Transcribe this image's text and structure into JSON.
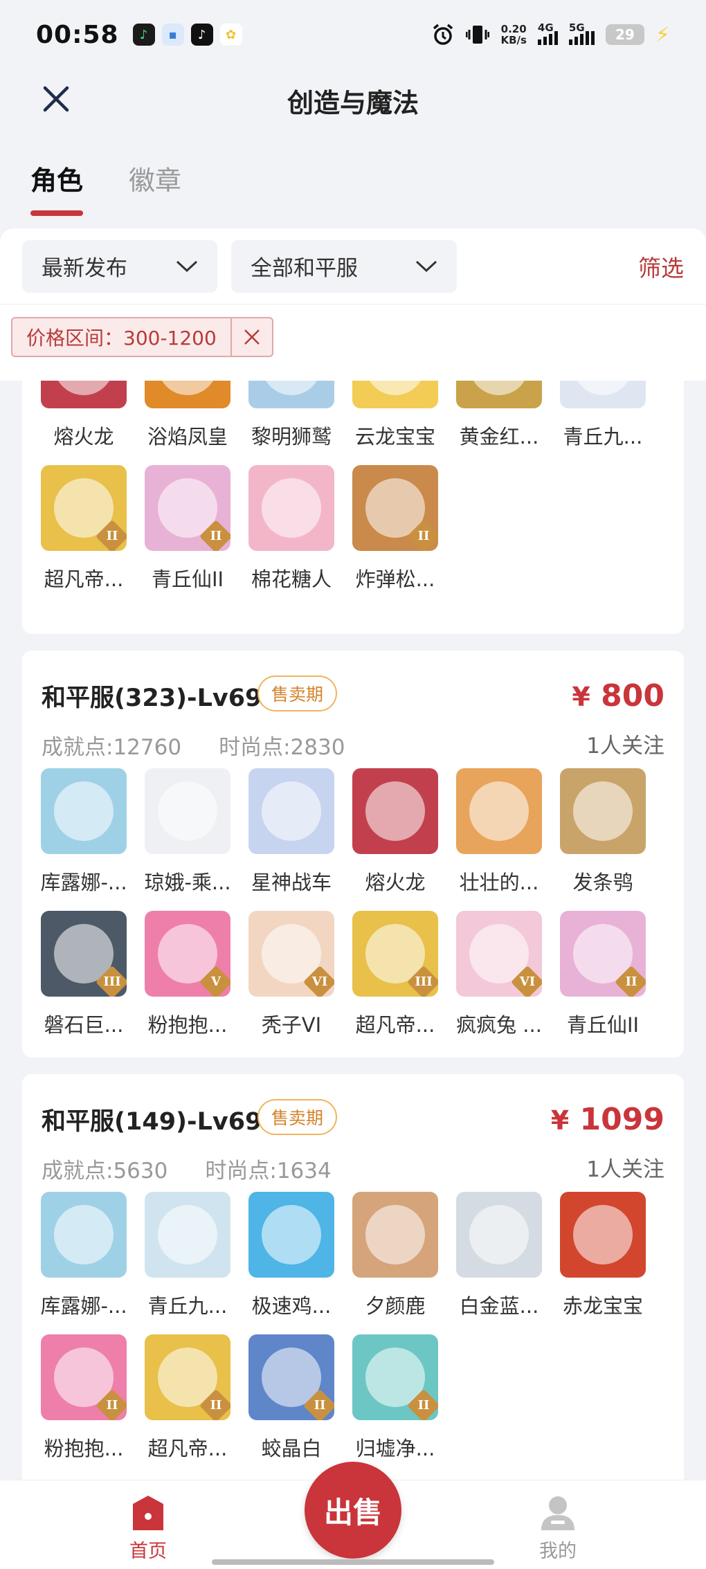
{
  "status_bar": {
    "time": "00:58",
    "speed": "0.20",
    "speed_unit": "KB/s",
    "net1": "4G",
    "net2": "5G",
    "battery": "29"
  },
  "header": {
    "title": "创造与魔法"
  },
  "tabs": [
    {
      "label": "角色",
      "active": true
    },
    {
      "label": "徽章",
      "active": false
    }
  ],
  "filters": {
    "sort": "最新发布",
    "server": "全部和平服",
    "filter_label": "筛选",
    "chip": "价格区间：300-1200"
  },
  "cards": [
    {
      "items": [
        {
          "name": "熔火龙",
          "color": "#c2404e"
        },
        {
          "name": "浴焰凤皇",
          "color": "#e08a2a"
        },
        {
          "name": "黎明狮鹫",
          "color": "#a9cde6"
        },
        {
          "name": "云龙宝宝",
          "color": "#f2cc55"
        },
        {
          "name": "黄金红...",
          "color": "#c9a24a"
        },
        {
          "name": "青丘九...",
          "color": "#dfe6f2"
        },
        {
          "name": "超凡帝...",
          "color": "#e8c04a",
          "tier": "II"
        },
        {
          "name": "青丘仙II",
          "color": "#e8b2d6",
          "tier": "II"
        },
        {
          "name": "棉花糖人",
          "color": "#f3b6c9"
        },
        {
          "name": "炸弹松...",
          "color": "#c98a4b",
          "tier": "II"
        }
      ]
    },
    {
      "title": "和平服(323)-Lv69",
      "badge": "售卖期",
      "price_symbol": "¥",
      "price": "800",
      "achievement_label": "成就点:",
      "achievement": "12760",
      "fashion_label": "时尚点:",
      "fashion": "2830",
      "followers": "1人关注",
      "items": [
        {
          "name": "库露娜-...",
          "color": "#9fd1e6"
        },
        {
          "name": "琼娥-乘...",
          "color": "#eef0f4"
        },
        {
          "name": "星神战车",
          "color": "#c6d4ef"
        },
        {
          "name": "熔火龙",
          "color": "#c2404e"
        },
        {
          "name": "壮壮的...",
          "color": "#e7a45a"
        },
        {
          "name": "发条鸮",
          "color": "#c9a46a"
        },
        {
          "name": "磐石巨...",
          "color": "#4d5966",
          "tier": "III"
        },
        {
          "name": "粉抱抱...",
          "color": "#ee7fab",
          "tier": "V"
        },
        {
          "name": "秃子VI",
          "color": "#f2d6c2",
          "tier": "VI"
        },
        {
          "name": "超凡帝...",
          "color": "#e8c04a",
          "tier": "III"
        },
        {
          "name": "疯疯兔 ...",
          "color": "#f3c8d8",
          "tier": "VI"
        },
        {
          "name": "青丘仙II",
          "color": "#e8b2d6",
          "tier": "II"
        }
      ]
    },
    {
      "title": "和平服(149)-Lv69",
      "badge": "售卖期",
      "price_symbol": "¥",
      "price": "1099",
      "achievement_label": "成就点:",
      "achievement": "5630",
      "fashion_label": "时尚点:",
      "fashion": "1634",
      "followers": "1人关注",
      "items": [
        {
          "name": "库露娜-...",
          "color": "#9fd1e6"
        },
        {
          "name": "青丘九...",
          "color": "#cfe4ef"
        },
        {
          "name": "极速鸡...",
          "color": "#4fb4e6"
        },
        {
          "name": "夕颜鹿",
          "color": "#d6a47a"
        },
        {
          "name": "白金蓝...",
          "color": "#d5dbe2"
        },
        {
          "name": "赤龙宝宝",
          "color": "#d2462e"
        },
        {
          "name": "粉抱抱...",
          "color": "#ee7fab",
          "tier": "II"
        },
        {
          "name": "超凡帝...",
          "color": "#e8c04a",
          "tier": "II"
        },
        {
          "name": "蛟晶白",
          "color": "#5f86c9",
          "tier": "II"
        },
        {
          "name": "归墟净...",
          "color": "#6cc7c4",
          "tier": "II"
        }
      ]
    }
  ],
  "bottom_nav": {
    "home": "首页",
    "sell": "出售",
    "mine": "我的"
  },
  "colors": {
    "accent": "#c9353a",
    "badge": "#f3b35a",
    "background": "#f1f3f7"
  }
}
